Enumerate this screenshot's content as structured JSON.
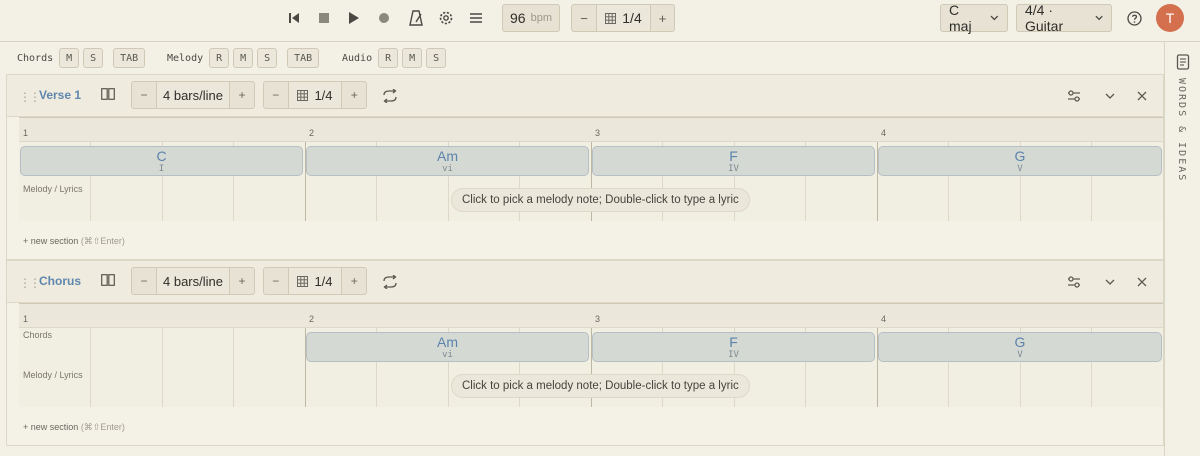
{
  "toolbar": {
    "bpm": {
      "value": "96",
      "unit": "bpm"
    },
    "grid": {
      "minus": "−",
      "value": "1/4",
      "plus": "+"
    },
    "key": "C maj",
    "meter": "4/4 · Guitar",
    "user_initial": "T"
  },
  "tracks": [
    {
      "label": "Chords",
      "buttons": [
        "M",
        "S"
      ],
      "tab": "TAB"
    },
    {
      "label": "Melody",
      "buttons": [
        "R",
        "M",
        "S"
      ],
      "tab": "TAB"
    },
    {
      "label": "Audio",
      "buttons": [
        "R",
        "M",
        "S"
      ]
    }
  ],
  "sidebar": {
    "label": "WORDS & IDEAS"
  },
  "sections": [
    {
      "name": "Verse 1",
      "bars_per_line": {
        "minus": "−",
        "value": "4 bars/line",
        "plus": "+"
      },
      "grid": {
        "minus": "−",
        "value": "1/4",
        "plus": "+"
      },
      "bar_numbers": [
        "1",
        "2",
        "3",
        "4"
      ],
      "row_labels": {
        "melody": "Melody / Lyrics"
      },
      "chords": [
        {
          "name": "C",
          "roman": "I",
          "bar": 1
        },
        {
          "name": "Am",
          "roman": "vi",
          "bar": 2
        },
        {
          "name": "F",
          "roman": "IV",
          "bar": 3
        },
        {
          "name": "G",
          "roman": "V",
          "bar": 4
        }
      ],
      "hint": "Click to pick a melody note; Double-click to type a lyric",
      "new_section": {
        "label": "+ new section",
        "shortcut": "(⌘⇧Enter)"
      }
    },
    {
      "name": "Chorus",
      "bars_per_line": {
        "minus": "−",
        "value": "4 bars/line",
        "plus": "+"
      },
      "grid": {
        "minus": "−",
        "value": "1/4",
        "plus": "+"
      },
      "bar_numbers": [
        "1",
        "2",
        "3",
        "4"
      ],
      "row_labels": {
        "chords": "Chords",
        "melody": "Melody / Lyrics"
      },
      "chords": [
        {
          "name": "Am",
          "roman": "vi",
          "bar": 2
        },
        {
          "name": "F",
          "roman": "IV",
          "bar": 3
        },
        {
          "name": "G",
          "roman": "V",
          "bar": 4
        }
      ],
      "hint": "Click to pick a melody note; Double-click to type a lyric",
      "new_section": {
        "label": "+ new section",
        "shortcut": "(⌘⇧Enter)"
      }
    }
  ]
}
